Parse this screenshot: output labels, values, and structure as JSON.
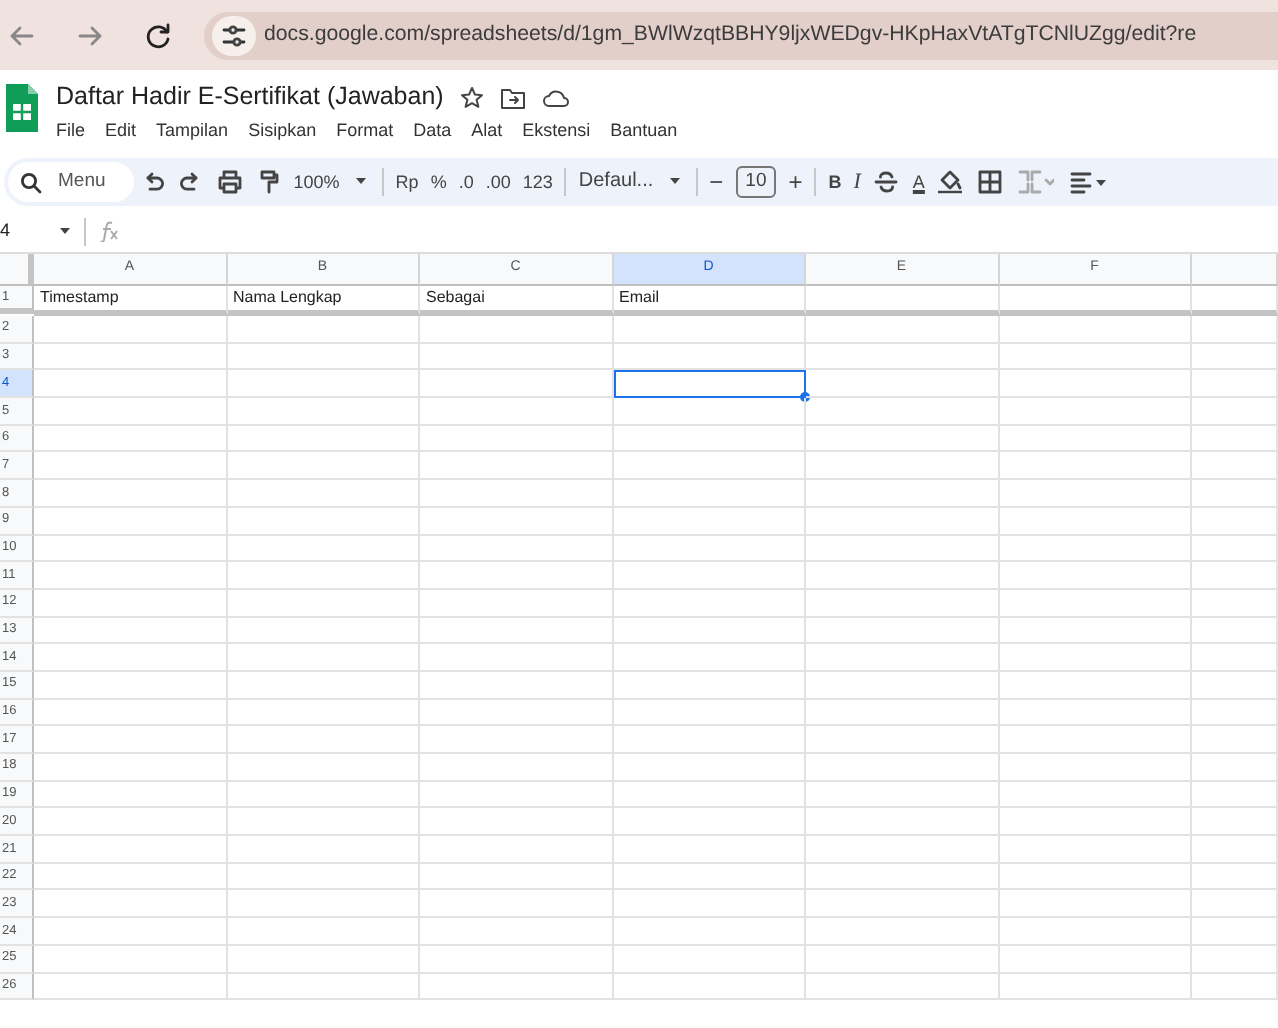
{
  "browser": {
    "address": "docs.google.com/spreadsheets/d/1gm_BWlWzqtBBHY9ljxWEDgv-HKpHaxVtATgTCNlUZgg/edit?re"
  },
  "document": {
    "title": "Daftar Hadir E-Sertifikat (Jawaban)"
  },
  "menu": [
    "File",
    "Edit",
    "Tampilan",
    "Sisipkan",
    "Format",
    "Data",
    "Alat",
    "Ekstensi",
    "Bantuan"
  ],
  "toolbar": {
    "search_label": "Menu",
    "zoom": "100%",
    "currency": "Rp",
    "percent": "%",
    "decimal_decrease": ".0",
    "decimal_increase": ".00",
    "number_format": "123",
    "font": "Defaul...",
    "font_size": "10",
    "decrease_size": "−",
    "increase_size": "+",
    "bold": "B",
    "italic": "I",
    "text_color": "A"
  },
  "formula_bar": {
    "cell_ref": "4"
  },
  "sheet": {
    "columns": [
      {
        "label": "A",
        "selected": false
      },
      {
        "label": "B",
        "selected": false
      },
      {
        "label": "C",
        "selected": false
      },
      {
        "label": "D",
        "selected": true
      },
      {
        "label": "E",
        "selected": false
      },
      {
        "label": "F",
        "selected": false
      }
    ],
    "rows": [
      {
        "label": "1",
        "selected": false,
        "cells": [
          "Timestamp",
          "Nama Lengkap",
          "Sebagai",
          "Email"
        ]
      },
      {
        "label": "2",
        "selected": false
      },
      {
        "label": "3",
        "selected": false
      },
      {
        "label": "4",
        "selected": true
      },
      {
        "label": "5",
        "selected": false
      },
      {
        "label": "6",
        "selected": false
      },
      {
        "label": "7",
        "selected": false
      },
      {
        "label": "8",
        "selected": false
      },
      {
        "label": "9",
        "selected": false
      },
      {
        "label": "10",
        "selected": false
      },
      {
        "label": "11",
        "selected": false
      },
      {
        "label": "12",
        "selected": false
      },
      {
        "label": "13",
        "selected": false
      },
      {
        "label": "14",
        "selected": false
      },
      {
        "label": "15",
        "selected": false
      },
      {
        "label": "16",
        "selected": false
      },
      {
        "label": "17",
        "selected": false
      },
      {
        "label": "18",
        "selected": false
      },
      {
        "label": "19",
        "selected": false
      },
      {
        "label": "20",
        "selected": false
      },
      {
        "label": "21",
        "selected": false
      },
      {
        "label": "22",
        "selected": false
      },
      {
        "label": "23",
        "selected": false
      },
      {
        "label": "24",
        "selected": false
      },
      {
        "label": "25",
        "selected": false
      },
      {
        "label": "26",
        "selected": false
      }
    ]
  }
}
